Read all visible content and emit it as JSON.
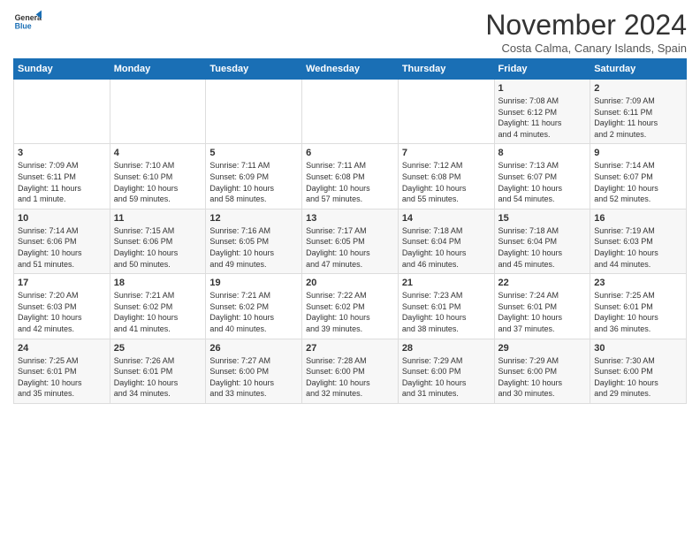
{
  "header": {
    "logo_line1": "General",
    "logo_line2": "Blue",
    "month": "November 2024",
    "location": "Costa Calma, Canary Islands, Spain"
  },
  "weekdays": [
    "Sunday",
    "Monday",
    "Tuesday",
    "Wednesday",
    "Thursday",
    "Friday",
    "Saturday"
  ],
  "weeks": [
    [
      {
        "day": "",
        "info": ""
      },
      {
        "day": "",
        "info": ""
      },
      {
        "day": "",
        "info": ""
      },
      {
        "day": "",
        "info": ""
      },
      {
        "day": "",
        "info": ""
      },
      {
        "day": "1",
        "info": "Sunrise: 7:08 AM\nSunset: 6:12 PM\nDaylight: 11 hours\nand 4 minutes."
      },
      {
        "day": "2",
        "info": "Sunrise: 7:09 AM\nSunset: 6:11 PM\nDaylight: 11 hours\nand 2 minutes."
      }
    ],
    [
      {
        "day": "3",
        "info": "Sunrise: 7:09 AM\nSunset: 6:11 PM\nDaylight: 11 hours\nand 1 minute."
      },
      {
        "day": "4",
        "info": "Sunrise: 7:10 AM\nSunset: 6:10 PM\nDaylight: 10 hours\nand 59 minutes."
      },
      {
        "day": "5",
        "info": "Sunrise: 7:11 AM\nSunset: 6:09 PM\nDaylight: 10 hours\nand 58 minutes."
      },
      {
        "day": "6",
        "info": "Sunrise: 7:11 AM\nSunset: 6:08 PM\nDaylight: 10 hours\nand 57 minutes."
      },
      {
        "day": "7",
        "info": "Sunrise: 7:12 AM\nSunset: 6:08 PM\nDaylight: 10 hours\nand 55 minutes."
      },
      {
        "day": "8",
        "info": "Sunrise: 7:13 AM\nSunset: 6:07 PM\nDaylight: 10 hours\nand 54 minutes."
      },
      {
        "day": "9",
        "info": "Sunrise: 7:14 AM\nSunset: 6:07 PM\nDaylight: 10 hours\nand 52 minutes."
      }
    ],
    [
      {
        "day": "10",
        "info": "Sunrise: 7:14 AM\nSunset: 6:06 PM\nDaylight: 10 hours\nand 51 minutes."
      },
      {
        "day": "11",
        "info": "Sunrise: 7:15 AM\nSunset: 6:06 PM\nDaylight: 10 hours\nand 50 minutes."
      },
      {
        "day": "12",
        "info": "Sunrise: 7:16 AM\nSunset: 6:05 PM\nDaylight: 10 hours\nand 49 minutes."
      },
      {
        "day": "13",
        "info": "Sunrise: 7:17 AM\nSunset: 6:05 PM\nDaylight: 10 hours\nand 47 minutes."
      },
      {
        "day": "14",
        "info": "Sunrise: 7:18 AM\nSunset: 6:04 PM\nDaylight: 10 hours\nand 46 minutes."
      },
      {
        "day": "15",
        "info": "Sunrise: 7:18 AM\nSunset: 6:04 PM\nDaylight: 10 hours\nand 45 minutes."
      },
      {
        "day": "16",
        "info": "Sunrise: 7:19 AM\nSunset: 6:03 PM\nDaylight: 10 hours\nand 44 minutes."
      }
    ],
    [
      {
        "day": "17",
        "info": "Sunrise: 7:20 AM\nSunset: 6:03 PM\nDaylight: 10 hours\nand 42 minutes."
      },
      {
        "day": "18",
        "info": "Sunrise: 7:21 AM\nSunset: 6:02 PM\nDaylight: 10 hours\nand 41 minutes."
      },
      {
        "day": "19",
        "info": "Sunrise: 7:21 AM\nSunset: 6:02 PM\nDaylight: 10 hours\nand 40 minutes."
      },
      {
        "day": "20",
        "info": "Sunrise: 7:22 AM\nSunset: 6:02 PM\nDaylight: 10 hours\nand 39 minutes."
      },
      {
        "day": "21",
        "info": "Sunrise: 7:23 AM\nSunset: 6:01 PM\nDaylight: 10 hours\nand 38 minutes."
      },
      {
        "day": "22",
        "info": "Sunrise: 7:24 AM\nSunset: 6:01 PM\nDaylight: 10 hours\nand 37 minutes."
      },
      {
        "day": "23",
        "info": "Sunrise: 7:25 AM\nSunset: 6:01 PM\nDaylight: 10 hours\nand 36 minutes."
      }
    ],
    [
      {
        "day": "24",
        "info": "Sunrise: 7:25 AM\nSunset: 6:01 PM\nDaylight: 10 hours\nand 35 minutes."
      },
      {
        "day": "25",
        "info": "Sunrise: 7:26 AM\nSunset: 6:01 PM\nDaylight: 10 hours\nand 34 minutes."
      },
      {
        "day": "26",
        "info": "Sunrise: 7:27 AM\nSunset: 6:00 PM\nDaylight: 10 hours\nand 33 minutes."
      },
      {
        "day": "27",
        "info": "Sunrise: 7:28 AM\nSunset: 6:00 PM\nDaylight: 10 hours\nand 32 minutes."
      },
      {
        "day": "28",
        "info": "Sunrise: 7:29 AM\nSunset: 6:00 PM\nDaylight: 10 hours\nand 31 minutes."
      },
      {
        "day": "29",
        "info": "Sunrise: 7:29 AM\nSunset: 6:00 PM\nDaylight: 10 hours\nand 30 minutes."
      },
      {
        "day": "30",
        "info": "Sunrise: 7:30 AM\nSunset: 6:00 PM\nDaylight: 10 hours\nand 29 minutes."
      }
    ]
  ]
}
